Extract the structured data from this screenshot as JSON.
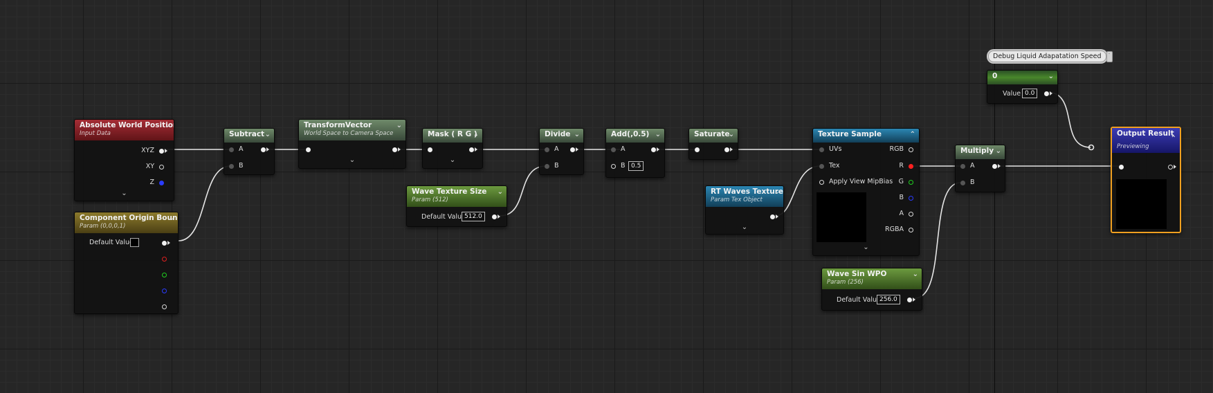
{
  "nodes": {
    "absolute_world_position": {
      "title": "Absolute World Position",
      "subtitle": "Input Data",
      "outputs": [
        "XYZ",
        "XY",
        "Z"
      ]
    },
    "component_origin_bound": {
      "title": "Component Origin Bound",
      "subtitle": "Param (0,0,0,1)",
      "default_value_label": "Default Value"
    },
    "subtract": {
      "title": "Subtract",
      "inputs": [
        "A",
        "B"
      ]
    },
    "transform_vector": {
      "title": "TransformVector",
      "subtitle": "World Space to Camera Space"
    },
    "mask": {
      "title": "Mask ( R G )"
    },
    "wave_texture_size": {
      "title": "Wave Texture Size",
      "subtitle": "Param (512)",
      "default_value_label": "Default Value",
      "default_value": "512.0"
    },
    "divide": {
      "title": "Divide",
      "inputs": [
        "A",
        "B"
      ]
    },
    "add": {
      "title": "Add(,0.5)",
      "input_a": "A",
      "input_b": "B",
      "b_value": "0.5"
    },
    "saturate": {
      "title": "Saturate"
    },
    "texture_sample": {
      "title": "Texture Sample",
      "inputs": [
        "UVs",
        "Tex",
        "Apply View MipBias"
      ],
      "outputs": [
        "RGB",
        "R",
        "G",
        "B",
        "A",
        "RGBA"
      ]
    },
    "rt_waves_texture": {
      "title": "RT Waves Texture",
      "subtitle": "Param Tex Object"
    },
    "wave_sin_wpo": {
      "title": "Wave Sin WPO",
      "subtitle": "Param (256)",
      "default_value_label": "Default Value",
      "default_value": "256.0"
    },
    "multiply": {
      "title": "Multiply",
      "inputs": [
        "A",
        "B"
      ]
    },
    "debug_constant": {
      "comment": "Debug Liquid Adapatation Speed",
      "title": "0",
      "value_label": "Value",
      "value": "0.0"
    },
    "output_result": {
      "title": "Output Result",
      "subtitle": "Previewing"
    }
  },
  "colors": {
    "canvas": "#262626",
    "wire": "#e6e6e6",
    "output_highlight": "#f0a020",
    "pin_red": "#ff2020",
    "pin_green": "#20d020",
    "pin_blue": "#2a3cff"
  },
  "icons": {
    "collapse": "chevron-down-icon",
    "expand": "chevron-down-icon",
    "output_collapse": "chevron-up-icon"
  }
}
